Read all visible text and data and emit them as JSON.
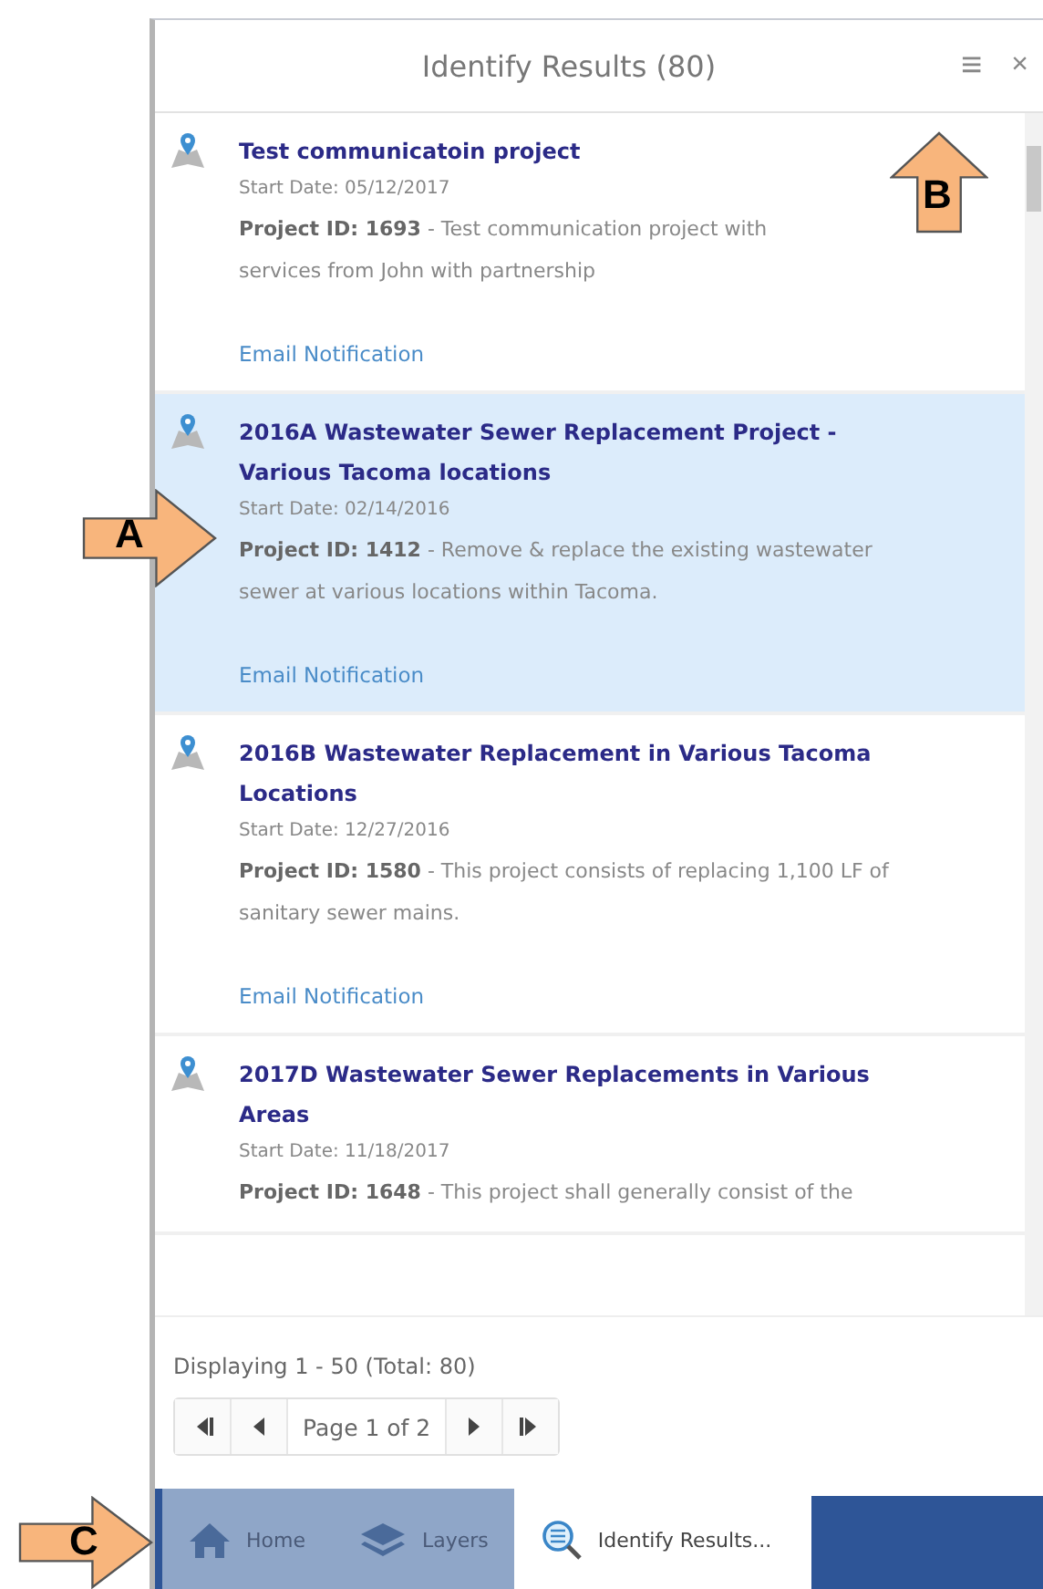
{
  "panel": {
    "title": "Identify Results (80)",
    "menu_icon": "≡",
    "close": "×"
  },
  "results": [
    {
      "title": "Test communicatoin project",
      "start_date": "Start Date: 05/12/2017",
      "project_id": "Project ID: 1693",
      "description": " - Test communication project with\nservices from John with partnership",
      "link": "Email Notification",
      "selected": false
    },
    {
      "title": "2016A Wastewater Sewer Replacement Project - Various Tacoma locations",
      "start_date": "Start Date: 02/14/2016",
      "project_id": "Project ID: 1412",
      "description": " - Remove & replace the existing wastewater sewer at various locations within Tacoma.",
      "link": "Email Notification",
      "selected": true
    },
    {
      "title": "2016B Wastewater Replacement in Various Tacoma Locations",
      "start_date": "Start Date: 12/27/2016",
      "project_id": "Project ID: 1580",
      "description": " - This project consists of replacing 1,100 LF of sanitary sewer mains.",
      "link": "Email Notification",
      "selected": false
    },
    {
      "title": "2017D Wastewater Sewer Replacements in Various Areas",
      "start_date": "Start Date: 11/18/2017",
      "project_id": "Project ID: 1648",
      "description": " - This project shall generally consist of the",
      "selected": false
    }
  ],
  "footer": {
    "displaying": "Displaying 1 - 50 (Total: 80)",
    "page": "Page 1 of 2"
  },
  "taskbar": [
    {
      "label": "Home",
      "kind": "home",
      "selected": false
    },
    {
      "label": "Layers",
      "kind": "layers",
      "selected": false
    },
    {
      "label": "Identify Results...",
      "kind": "identify",
      "selected": true
    }
  ],
  "callouts": [
    {
      "label": "A",
      "kind": "right"
    },
    {
      "label": "B",
      "kind": "up"
    },
    {
      "label": "C",
      "kind": "right"
    }
  ]
}
